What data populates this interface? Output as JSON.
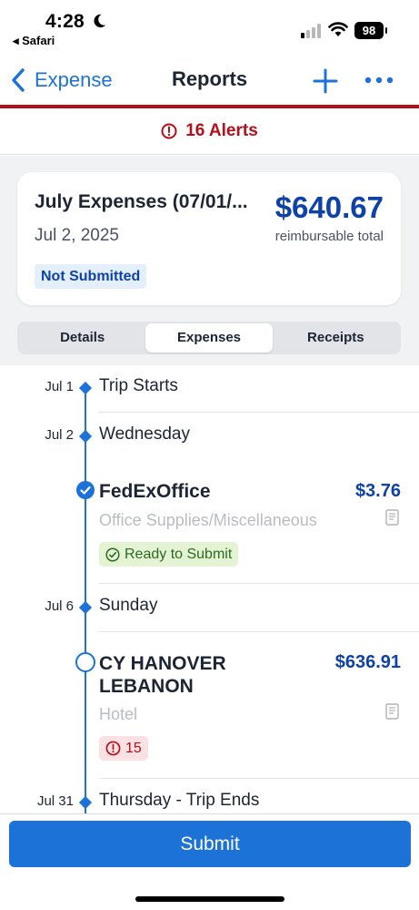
{
  "status_bar": {
    "time": "4:28",
    "back_app": "◂ Safari",
    "battery": "98"
  },
  "nav": {
    "back_label": "Expense",
    "title": "Reports"
  },
  "alerts": {
    "label": "16 Alerts"
  },
  "report": {
    "name": "July Expenses (07/01/...",
    "date": "Jul 2, 2025",
    "amount": "$640.67",
    "amount_caption": "reimbursable total",
    "status": "Not Submitted"
  },
  "tabs": [
    {
      "label": "Details",
      "active": false
    },
    {
      "label": "Expenses",
      "active": true
    },
    {
      "label": "Receipts",
      "active": false
    }
  ],
  "timeline": {
    "days": [
      {
        "date": "Jul 1",
        "text": "Trip Starts"
      },
      {
        "date": "Jul 2",
        "text": "Wednesday"
      },
      {
        "date": "Jul 6",
        "text": "Sunday"
      },
      {
        "date": "Jul 31",
        "text": "Thursday - Trip Ends"
      }
    ],
    "expenses": [
      {
        "vendor": "FedExOffice",
        "amount": "$3.76",
        "category": "Office Supplies/Miscellaneous",
        "status": "Ready to Submit"
      },
      {
        "vendor_line1": "CY HANOVER",
        "vendor_line2": "LEBANON",
        "amount": "$636.91",
        "category": "Hotel",
        "alert_count": "15"
      }
    ]
  },
  "footer": {
    "submit_label": "Submit"
  },
  "colors": {
    "accent": "#1d72d8",
    "amount_blue": "#0e42a8",
    "alert_red": "#b40f1a",
    "ready_green": "#2d6a23"
  }
}
